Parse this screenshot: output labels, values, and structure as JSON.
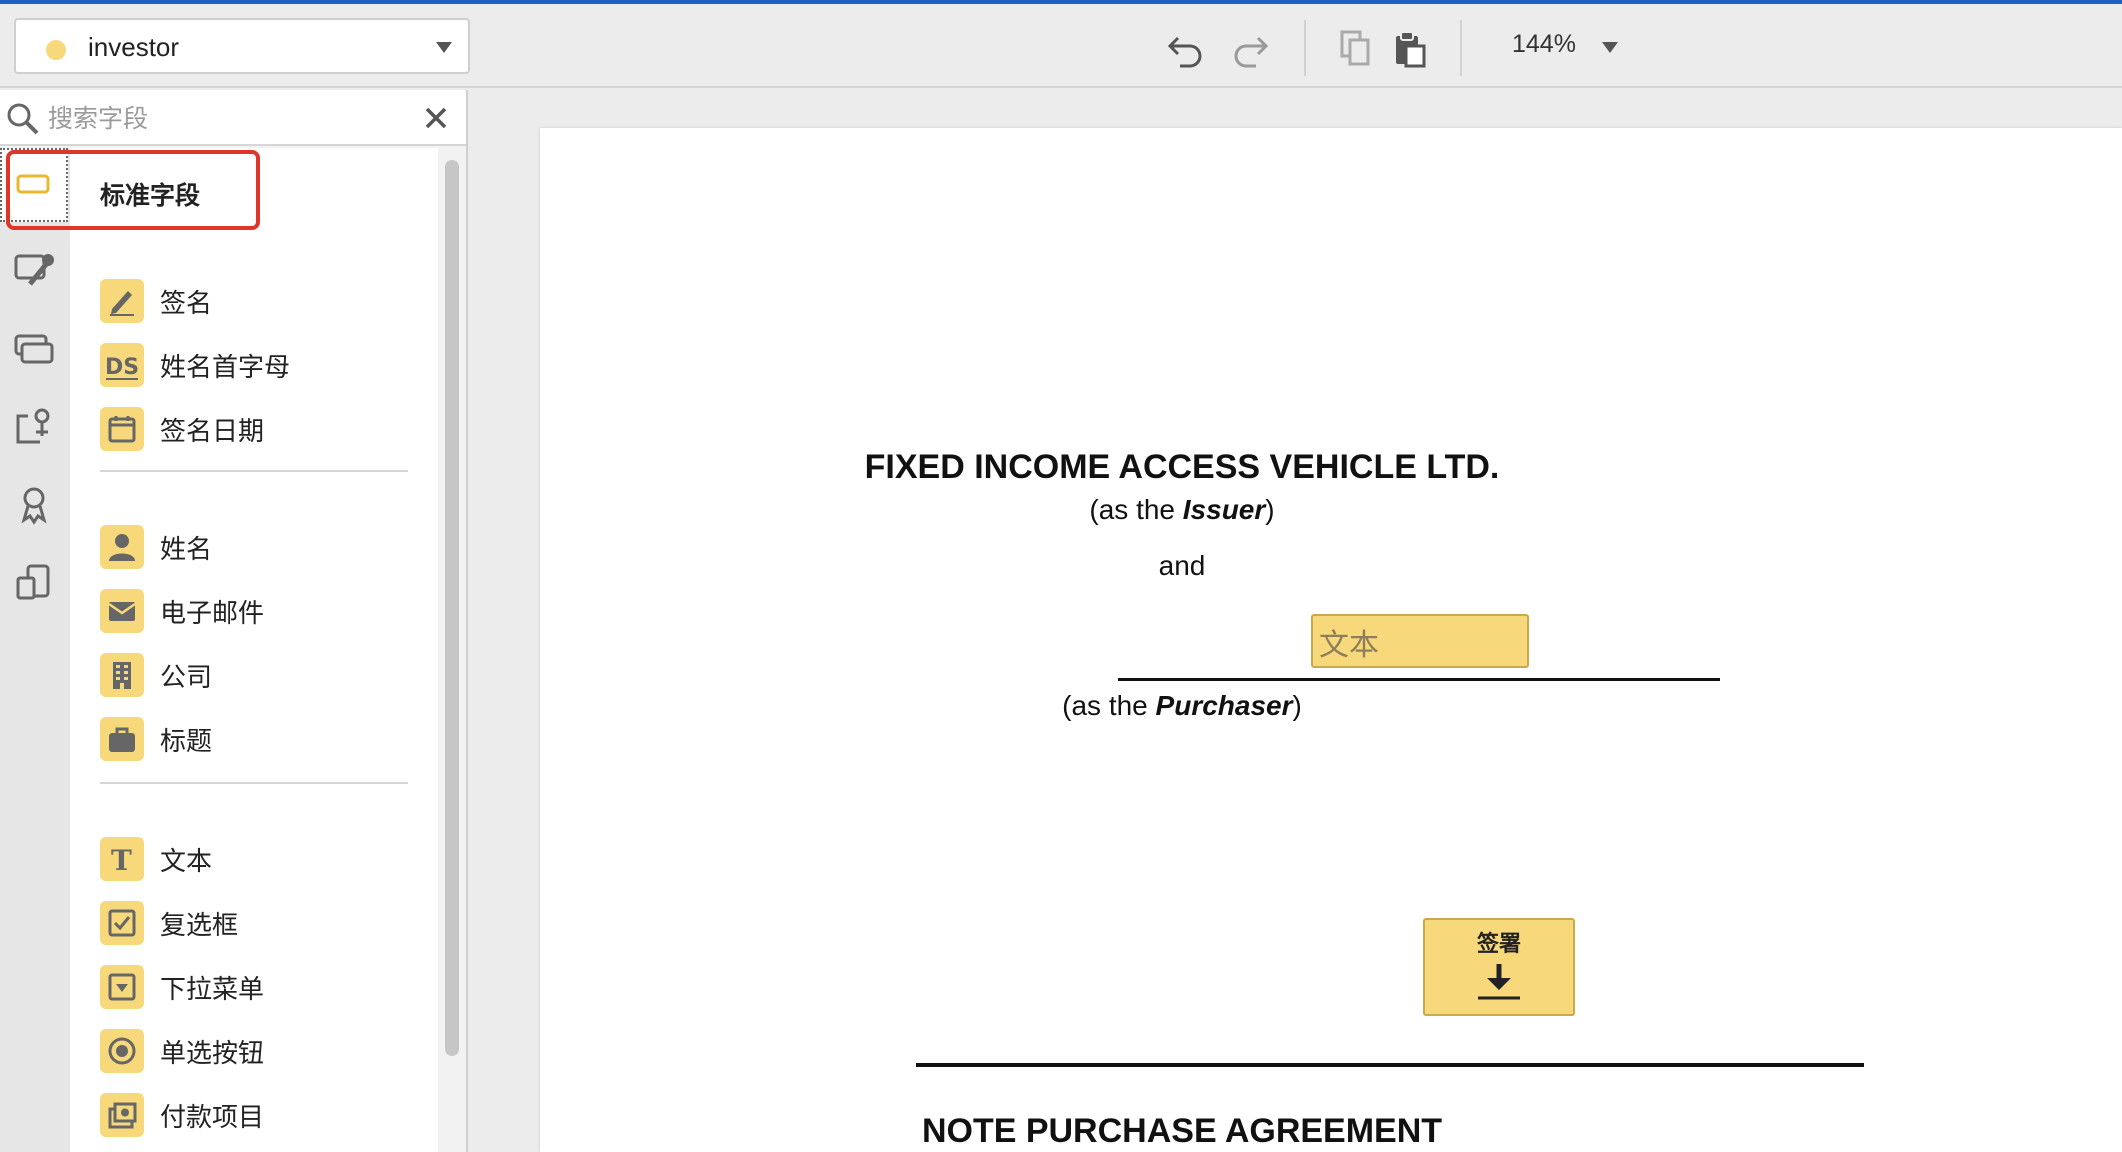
{
  "toolbar": {
    "recipient": {
      "name": "investor",
      "color": "#f7d97c"
    },
    "zoom": "144%",
    "icons": [
      "undo-icon",
      "redo-icon",
      "copy-icon",
      "paste-icon"
    ]
  },
  "search": {
    "placeholder": "搜索字段"
  },
  "rail": [
    "standard-fields-icon",
    "customize-icon",
    "bulk-icon",
    "custom-field-icon",
    "award-icon",
    "devices-icon"
  ],
  "fields": {
    "section_title": "标准字段",
    "group1": [
      {
        "label": "签名",
        "icon": "signature-icon"
      },
      {
        "label": "姓名首字母",
        "icon": "initials-icon"
      },
      {
        "label": "签名日期",
        "icon": "date-signed-icon"
      }
    ],
    "group2": [
      {
        "label": "姓名",
        "icon": "person-icon"
      },
      {
        "label": "电子邮件",
        "icon": "email-icon"
      },
      {
        "label": "公司",
        "icon": "company-icon"
      },
      {
        "label": "标题",
        "icon": "title-icon"
      }
    ],
    "group3": [
      {
        "label": "文本",
        "icon": "text-icon"
      },
      {
        "label": "复选框",
        "icon": "checkbox-icon"
      },
      {
        "label": "下拉菜单",
        "icon": "dropdown-icon"
      },
      {
        "label": "单选按钮",
        "icon": "radio-icon"
      },
      {
        "label": "付款项目",
        "icon": "payment-icon"
      }
    ]
  },
  "document": {
    "title": "FIXED INCOME ACCESS VEHICLE LTD.",
    "issuer_prefix": "(as the ",
    "issuer_word": "Issuer",
    "issuer_suffix": ")",
    "and": "and",
    "text_field": "文本",
    "purchaser_prefix": "(as the ",
    "purchaser_word": "Purchaser",
    "purchaser_suffix": ")",
    "sign_label": "签署",
    "agreement_title": "NOTE PURCHASE AGREEMENT"
  },
  "colors": {
    "accent": "#1f5fbf",
    "field_yellow": "#f7d97c",
    "highlight": "#e0352b"
  }
}
